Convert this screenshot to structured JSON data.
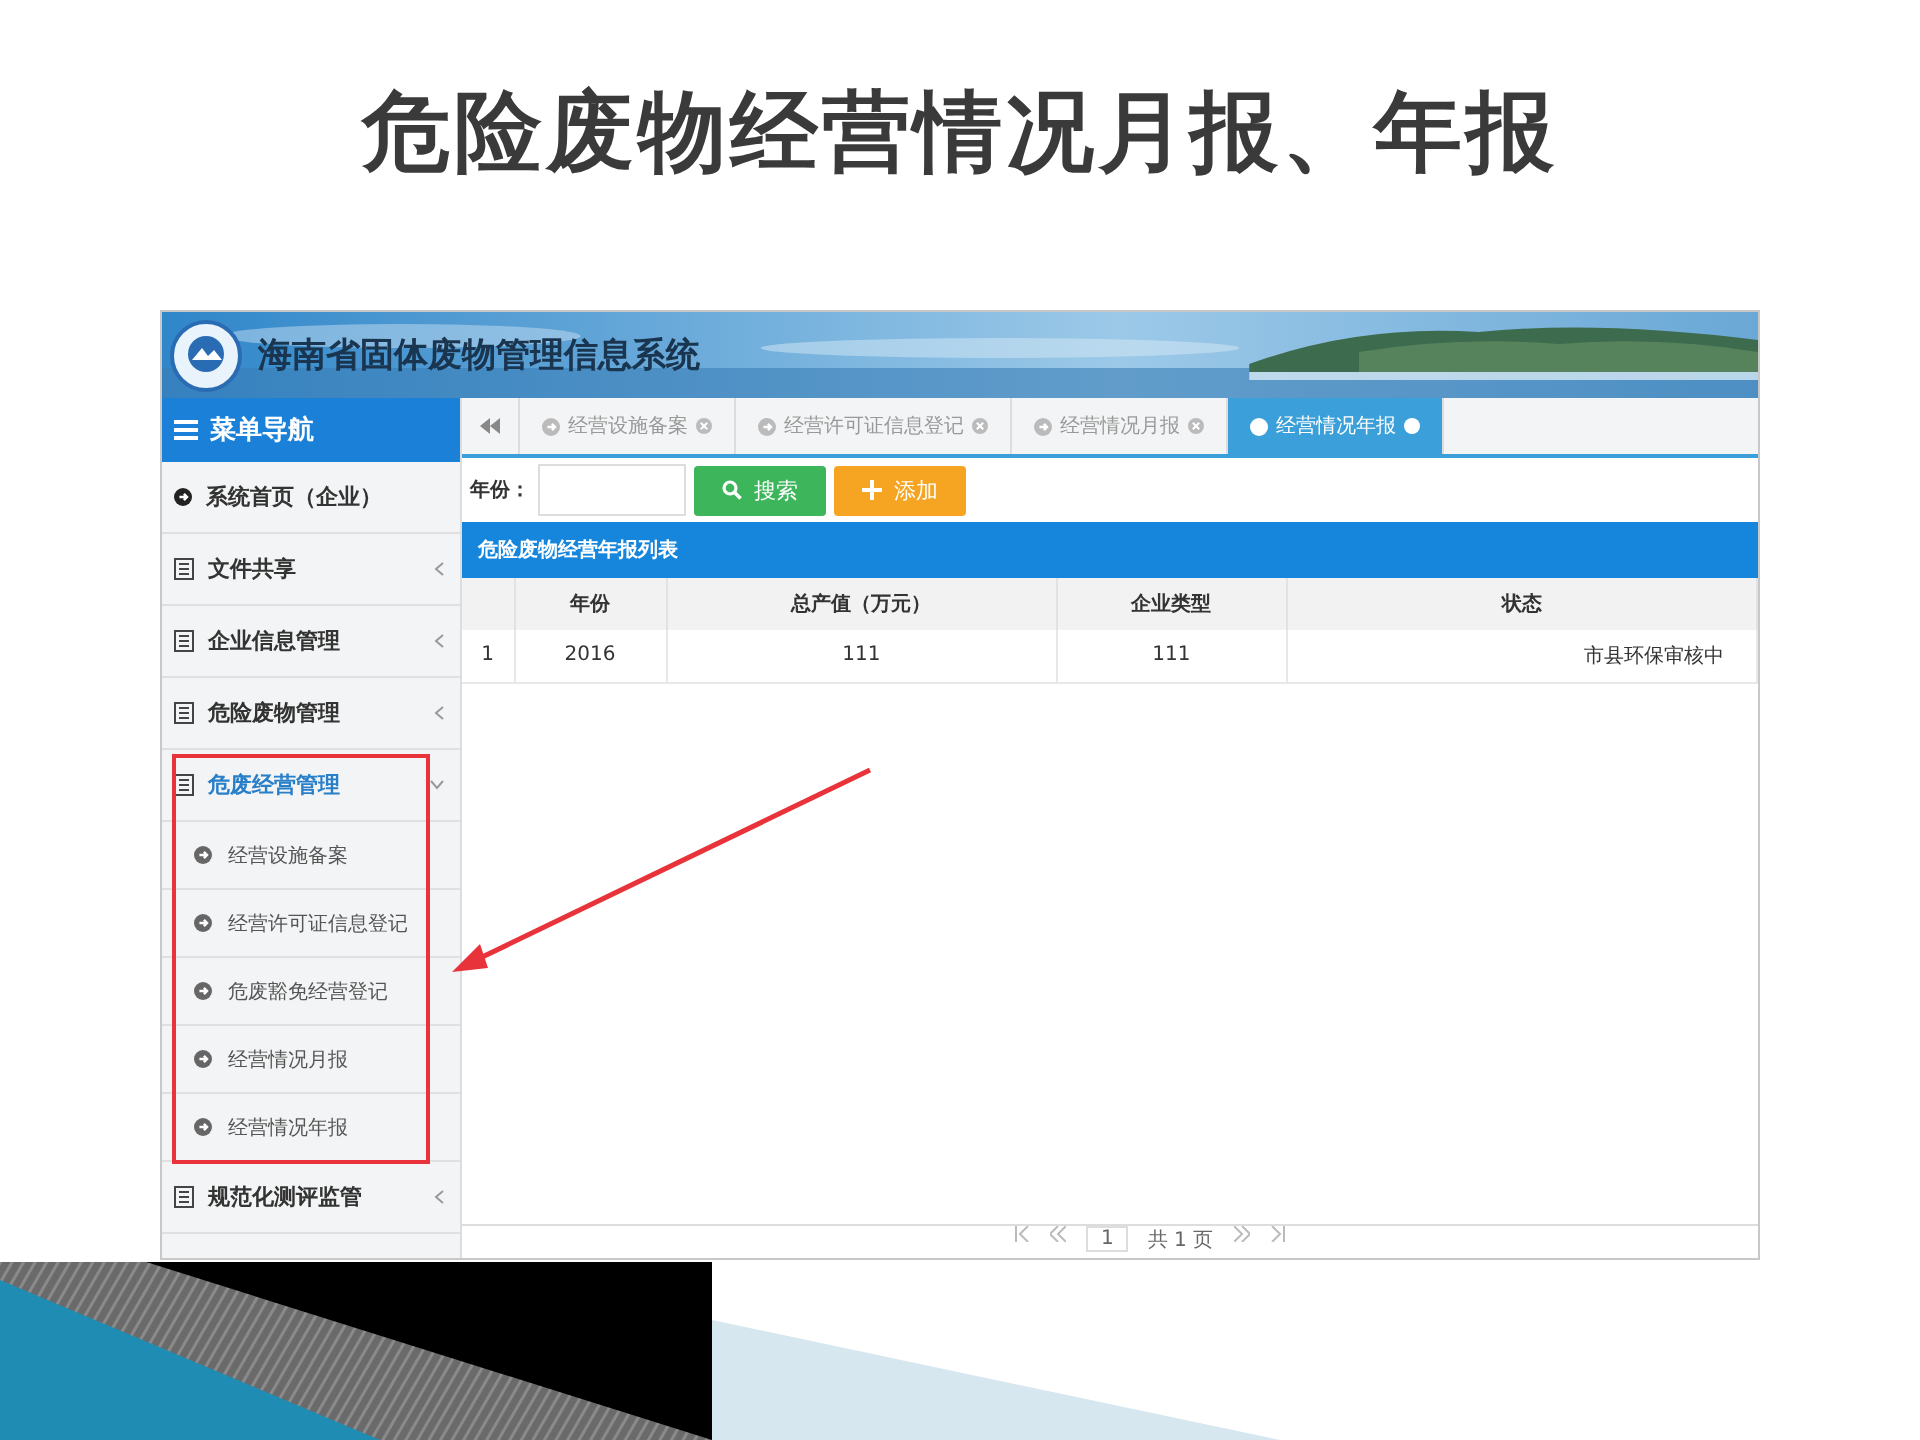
{
  "title": "危险废物经营情况月报、年报",
  "app": {
    "system_title": "海南省固体废物管理信息系统",
    "nav_title": "菜单导航",
    "menu": [
      {
        "label": "系统首页（企业）",
        "kind": "link"
      },
      {
        "label": "文件共享",
        "kind": "group",
        "expanded": false
      },
      {
        "label": "企业信息管理",
        "kind": "group",
        "expanded": false
      },
      {
        "label": "危险废物管理",
        "kind": "group",
        "expanded": false
      },
      {
        "label": "危废经营管理",
        "kind": "group",
        "expanded": true,
        "children": [
          {
            "label": "经营设施备案"
          },
          {
            "label": "经营许可证信息登记"
          },
          {
            "label": "危废豁免经营登记"
          },
          {
            "label": "经营情况月报"
          },
          {
            "label": "经营情况年报"
          }
        ]
      },
      {
        "label": "规范化测评监管",
        "kind": "group",
        "expanded": false
      }
    ],
    "tabs": [
      {
        "label": "经营设施备案",
        "selected": false
      },
      {
        "label": "经营许可证信息登记",
        "selected": false
      },
      {
        "label": "经营情况月报",
        "selected": false
      },
      {
        "label": "经营情况年报",
        "selected": true
      }
    ],
    "filter_label": "年份：",
    "buttons": [
      {
        "label": "搜索",
        "kind": "search"
      },
      {
        "label": "添加",
        "kind": "add"
      }
    ],
    "panel_title": "危险废物经营年报列表",
    "table": {
      "columns": [
        "年份",
        "总产值（万元）",
        "企业类型",
        "状态"
      ],
      "rows": [
        {
          "index": "1",
          "cells": [
            "2016",
            "111",
            "111",
            "市县环保审核中"
          ]
        }
      ]
    },
    "pager": {
      "page": "1",
      "total": "共 1 页"
    }
  }
}
